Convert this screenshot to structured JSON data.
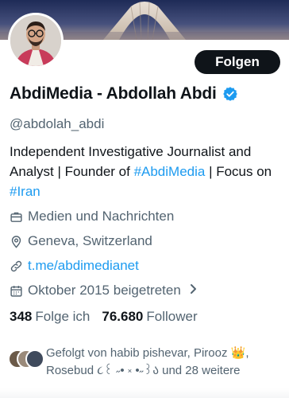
{
  "profile": {
    "display_name": "AbdiMedia - Abdollah Abdi",
    "handle": "@abdolah_abdi",
    "follow_label": "Folgen",
    "bio_part1": "Independent Investigative Journalist and Analyst | Founder of ",
    "bio_hashtag1": "#AbdiMedia",
    "bio_part2": " | Focus on ",
    "bio_hashtag2": "#Iran"
  },
  "meta": {
    "category": "Medien und Nachrichten",
    "location": "Geneva, Switzerland",
    "website": "t.me/abdimedianet",
    "joined": "Oktober 2015 beigetreten"
  },
  "stats": {
    "following_count": "348",
    "following_label": "Folge ich",
    "followers_count": "76.680",
    "followers_label": "Follower"
  },
  "followed_by": {
    "text_line": "Gefolgt von habib pishevar, Pirooz 👑, Rosebud ૮꒰ ˶• ༝ •˶꒱ა und 28 weitere"
  },
  "icons": {
    "verified": "verified-badge-icon",
    "category": "briefcase-icon",
    "location": "location-pin-icon",
    "website": "link-icon",
    "joined": "calendar-icon",
    "chevron": "chevron-right-icon"
  },
  "colors": {
    "accent": "#1d9bf0",
    "text": "#0f1419",
    "secondary": "#536471",
    "button_bg": "#0f1419"
  }
}
